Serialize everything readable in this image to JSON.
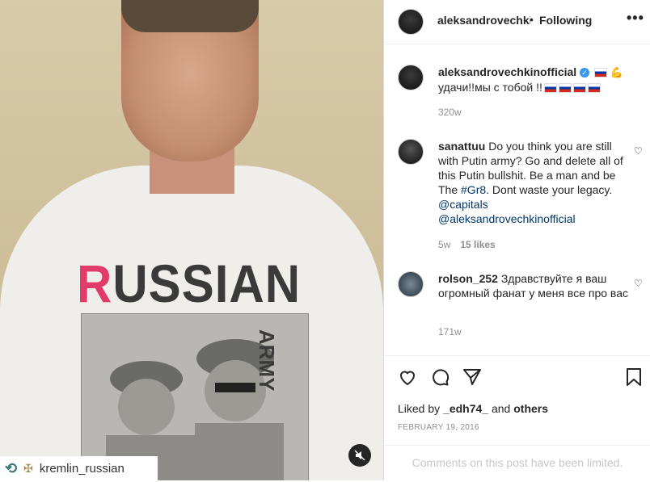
{
  "media": {
    "shirt_text_first": "R",
    "shirt_text_rest": "USSIAN",
    "shirt_subtext": "ARMY",
    "repost_icon": "repost-icon",
    "repost_user": "kremlin_russian",
    "mute_icon": "mute-icon"
  },
  "header": {
    "username": "aleksandrovechkinof",
    "dot": "•",
    "follow_label": "Following",
    "more_label": "•••"
  },
  "caption": {
    "username": "aleksandrovechkinofficial",
    "text": "удачи!!мы с тобой !!",
    "time": "320w"
  },
  "comments": [
    {
      "username": "sanattuu",
      "text_part1": " Do you think you are still with Putin army? Go and delete all of this Putin bullshit. Be a man and be The ",
      "hashtag": "#Gr8",
      "text_part2": ". Dont waste your legacy. ",
      "mention1": "@capitals",
      "mention2": "@aleksandrovechkinofficial",
      "time": "5w",
      "likes": "15 likes"
    },
    {
      "username": "rolson_252",
      "text": " Здравствуйте я ваш огромный фанат у меня все про вас",
      "time": "171w"
    }
  ],
  "actions": {
    "liked_prefix": "Liked by ",
    "liked_user": "_edh74_",
    "liked_mid": " and ",
    "liked_others": "others",
    "date": "FEBRUARY 19, 2016",
    "limited": "Comments on this post have been limited."
  },
  "colors": {
    "link": "#00376b",
    "meta": "#8e8e8e",
    "verified": "#3897f0"
  }
}
